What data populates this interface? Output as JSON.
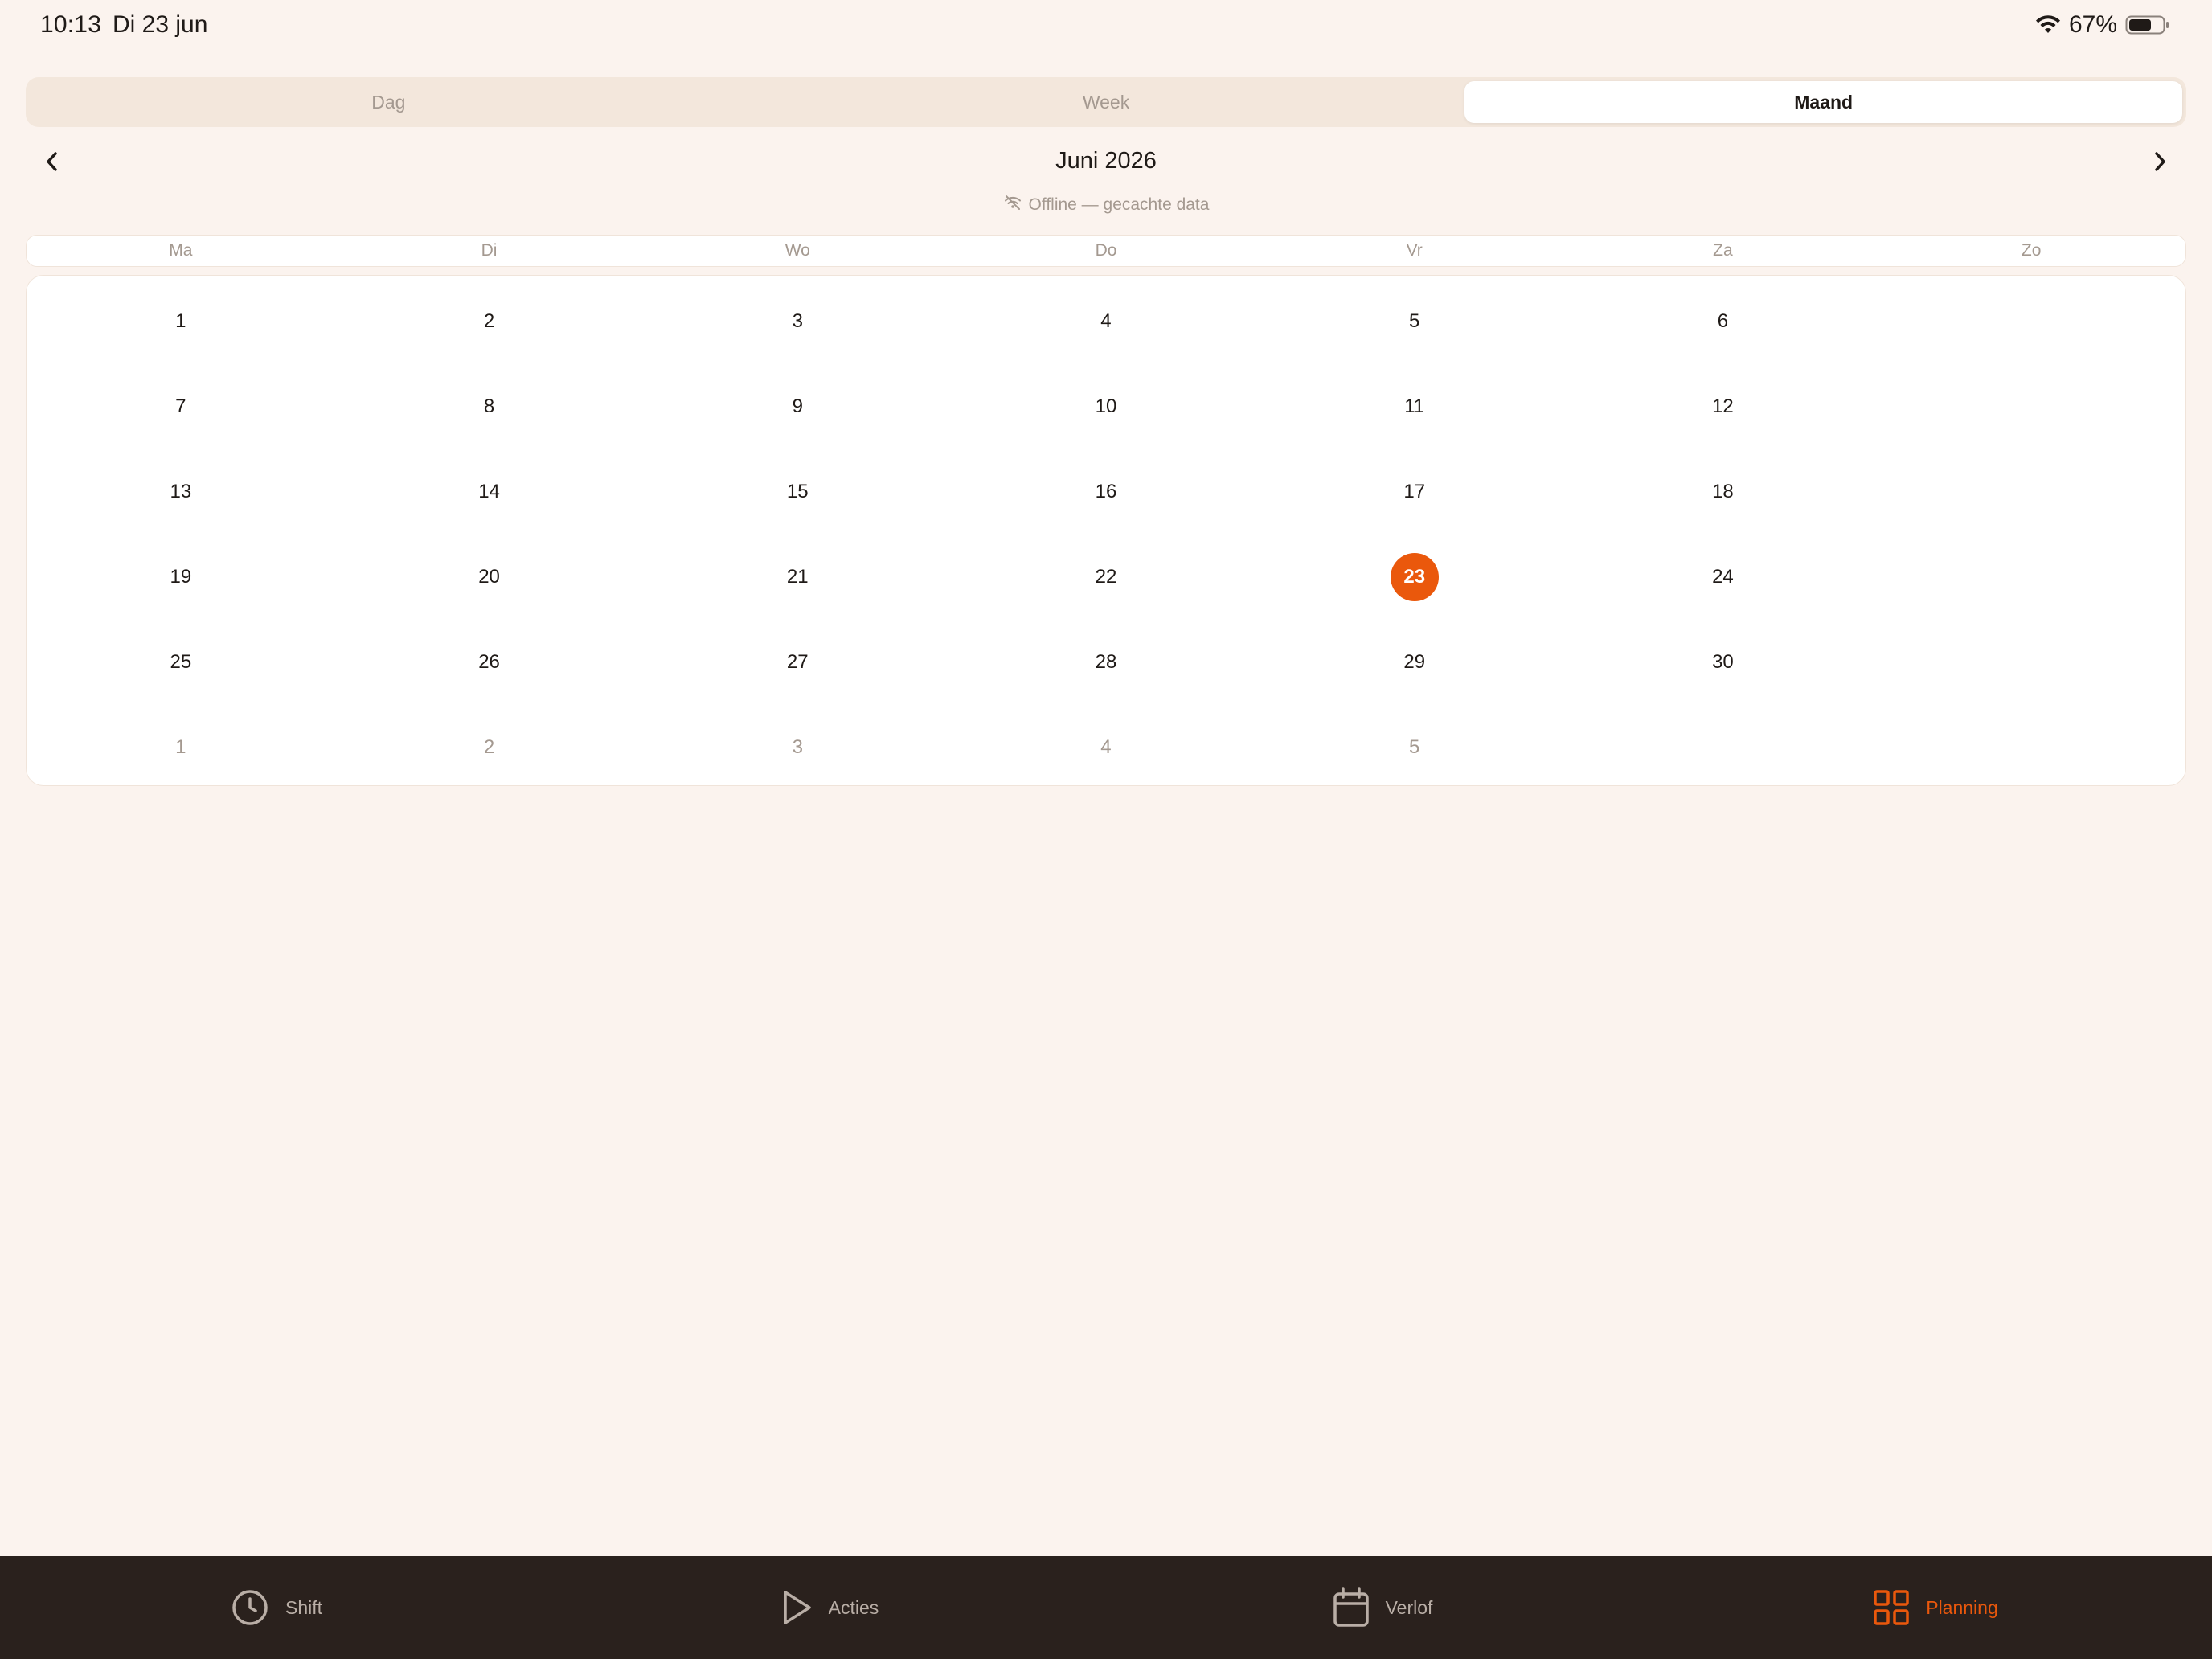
{
  "status_bar": {
    "time": "10:13",
    "date": "Di 23 jun",
    "battery": "67%"
  },
  "view_switch": {
    "options": [
      "Dag",
      "Week",
      "Maand"
    ],
    "selected": "Maand"
  },
  "calendar": {
    "month_title": "Juni 2026",
    "offline_note": "Offline — gecachte data",
    "weekdays": [
      "Ma",
      "Di",
      "Wo",
      "Do",
      "Vr",
      "Za",
      "Zo"
    ],
    "weeks": [
      [
        "1",
        "2",
        "3",
        "4",
        "5",
        "6",
        ""
      ],
      [
        "7",
        "8",
        "9",
        "10",
        "11",
        "12",
        ""
      ],
      [
        "13",
        "14",
        "15",
        "16",
        "17",
        "18",
        ""
      ],
      [
        "19",
        "20",
        "21",
        "22",
        "23",
        "24",
        ""
      ],
      [
        "25",
        "26",
        "27",
        "28",
        "29",
        "30",
        ""
      ],
      [
        "1",
        "2",
        "3",
        "4",
        "5",
        "",
        ""
      ]
    ],
    "today": "23"
  },
  "tabs": [
    {
      "label": "Shift",
      "icon": "clock-icon"
    },
    {
      "label": "Acties",
      "icon": "play-icon"
    },
    {
      "label": "Verlof",
      "icon": "calendar-icon"
    },
    {
      "label": "Planning",
      "icon": "grid-icon"
    }
  ],
  "active_tab": "Planning",
  "colors": {
    "accent": "#ea580c",
    "background": "#fbf3ee",
    "tab_bar": "#2a211d",
    "muted_text": "#a49990"
  }
}
